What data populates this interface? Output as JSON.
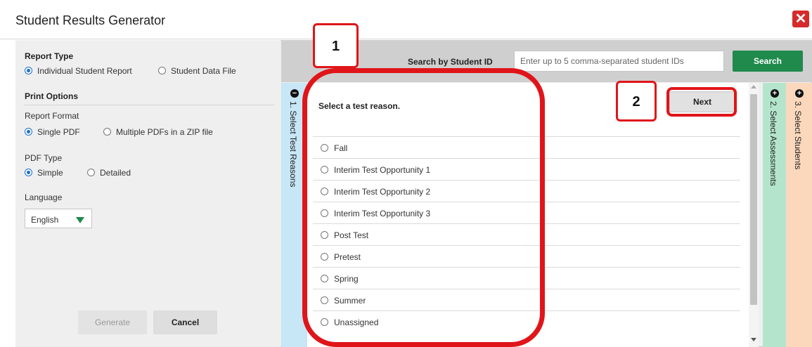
{
  "window": {
    "title": "Student Results Generator"
  },
  "left_panel": {
    "report_type": {
      "title": "Report Type",
      "options": [
        {
          "label": "Individual Student Report",
          "selected": true
        },
        {
          "label": "Student Data File",
          "selected": false
        }
      ]
    },
    "print_options": {
      "title": "Print Options",
      "report_format": {
        "label": "Report Format",
        "options": [
          {
            "label": "Single PDF",
            "selected": true
          },
          {
            "label": "Multiple PDFs in a ZIP file",
            "selected": false
          }
        ]
      },
      "pdf_type": {
        "label": "PDF Type",
        "options": [
          {
            "label": "Simple",
            "selected": true
          },
          {
            "label": "Detailed",
            "selected": false
          }
        ]
      },
      "language": {
        "label": "Language",
        "value": "English"
      }
    },
    "generate_label": "Generate",
    "cancel_label": "Cancel"
  },
  "search": {
    "label": "Search by Student ID",
    "placeholder": "Enter up to 5 comma-separated student IDs",
    "button_label": "Search"
  },
  "steps": [
    {
      "number": "1.",
      "label": "Select Test Reasons",
      "state": "expanded"
    },
    {
      "number": "2.",
      "label": "Select Assessments",
      "state": "collapsed"
    },
    {
      "number": "3.",
      "label": "Select Students",
      "state": "collapsed"
    }
  ],
  "test_reasons": {
    "heading": "Select a test reason.",
    "next_label": "Next",
    "options": [
      "Fall",
      "Interim Test Opportunity 1",
      "Interim Test Opportunity 2",
      "Interim Test Opportunity 3",
      "Post Test",
      "Pretest",
      "Spring",
      "Summer",
      "Unassigned"
    ]
  },
  "callouts": [
    {
      "number": "1"
    },
    {
      "number": "2"
    }
  ],
  "colors": {
    "accent_green": "#1f8a4c",
    "callout_red": "#e0151a",
    "close_red": "#d62b2b",
    "step1_blue": "#c7e6f6",
    "step2_green": "#b4e5cc",
    "step3_orange": "#fbd8bc"
  }
}
